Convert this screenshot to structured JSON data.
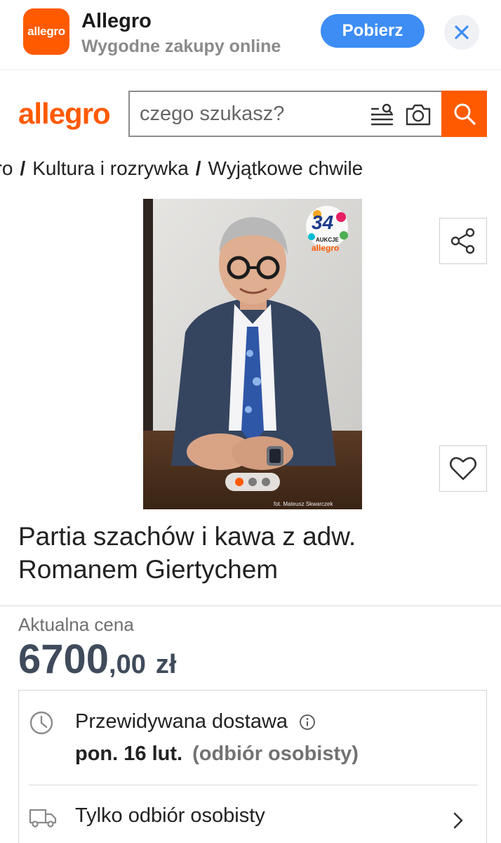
{
  "banner": {
    "icon_text": "allegro",
    "app_name": "Allegro",
    "subtitle": "Wygodne zakupy online",
    "cta_label": "Pobierz"
  },
  "header": {
    "logo": "allegro",
    "search_placeholder": "czego szukasz?"
  },
  "breadcrumb": [
    "gro",
    "Kultura i rozrywka",
    "Wyjątkowe chwile"
  ],
  "breadcrumb_separator": "/",
  "gallery": {
    "badge_number": "34",
    "badge_text": "AUKCJE",
    "badge_brand": "allegro",
    "photo_credit": "fot. Mateusz Skwarczek",
    "image_count": 3,
    "active_index": 0
  },
  "product": {
    "title": "Partia szachów i kawa z adw. Romanem Giertychem"
  },
  "price": {
    "label": "Aktualna cena",
    "integer": "6700",
    "fraction": ",00",
    "currency": "zł"
  },
  "delivery": {
    "label": "Przewidywana dostawa",
    "date": "pon. 16 lut.",
    "method": "(odbiór osobisty)",
    "pickup_label": "Tylko odbiór osobisty"
  },
  "colors": {
    "brand": "#ff5a00",
    "cta_blue": "#3d8df5",
    "price": "#3f4b5b"
  },
  "icons": [
    "close-icon",
    "filter-icon",
    "camera-icon",
    "search-icon",
    "share-icon",
    "heart-icon",
    "clock-icon",
    "info-icon",
    "truck-icon",
    "chevron-right-icon"
  ]
}
